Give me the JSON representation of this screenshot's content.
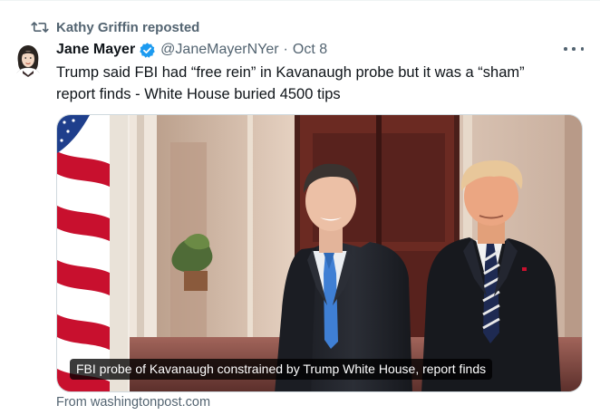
{
  "repost": {
    "label": "Kathy Griffin reposted",
    "icon": "repost-icon"
  },
  "author": {
    "name": "Jane Mayer",
    "handle": "@JaneMayerNYer",
    "separator": "·",
    "date": "Oct 8",
    "verified_color": "#1d9bf0"
  },
  "tweet": {
    "line1": "Trump said FBI had “free rein” in Kavanaugh probe but it was a “sham”",
    "line2": "report finds - White House buried 4500 tips"
  },
  "card": {
    "caption": "FBI probe of Kavanaugh constrained by Trump White House, report finds",
    "source": "From washingtonpost.com"
  },
  "colors": {
    "secondary_text": "#536471",
    "primary_text": "#0f1419",
    "accent": "#1d9bf0"
  }
}
